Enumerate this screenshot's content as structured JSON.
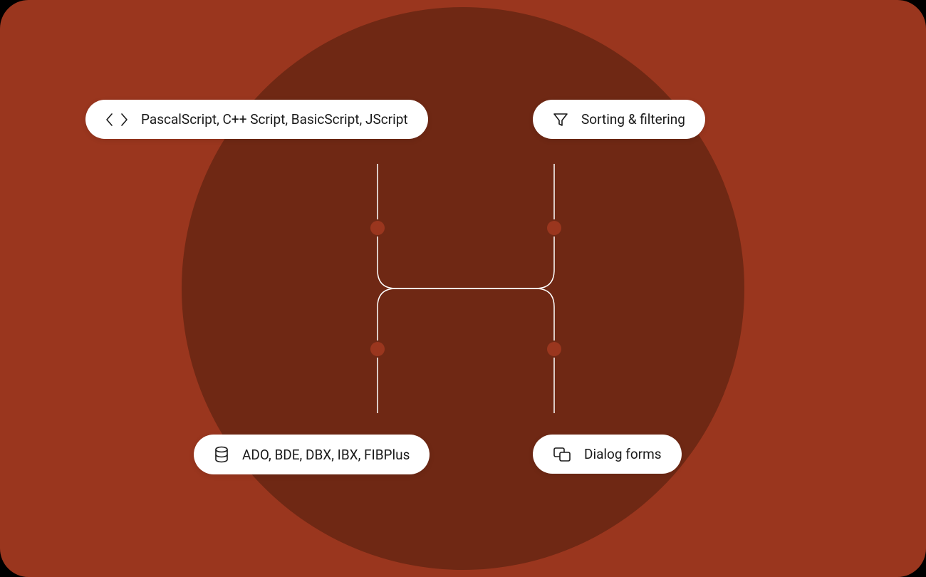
{
  "diagram": {
    "nodes": {
      "top_left": {
        "icon": "code",
        "label": "PascalScript, C++ Script, BasicScript, JScript"
      },
      "top_right": {
        "icon": "filter",
        "label": "Sorting & filtering"
      },
      "bottom_left": {
        "icon": "database",
        "label": "ADO, BDE, DBX, IBX, FIBPlus"
      },
      "bottom_right": {
        "icon": "dialog",
        "label": "Dialog forms"
      }
    },
    "colors": {
      "background": "#9a361e",
      "circle": "#6f2814",
      "pill_bg": "#ffffff",
      "wire": "#ffffff",
      "dot": "#9a361e"
    }
  }
}
